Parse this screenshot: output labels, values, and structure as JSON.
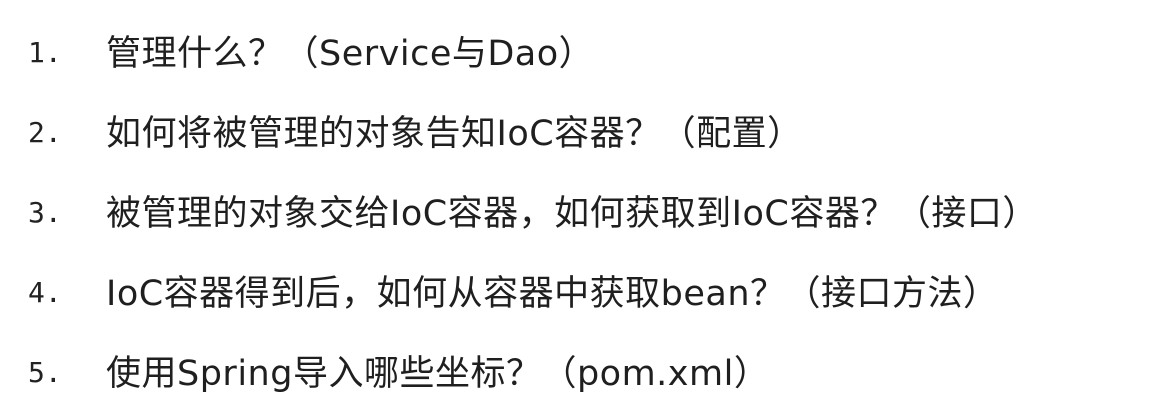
{
  "slide": {
    "items": [
      {
        "number": "1.",
        "text": "管理什么？（Service与Dao）"
      },
      {
        "number": "2.",
        "text": "如何将被管理的对象告知IoC容器？（配置）"
      },
      {
        "number": "3.",
        "text": "被管理的对象交给IoC容器，如何获取到IoC容器？（接口）"
      },
      {
        "number": "4.",
        "text": "IoC容器得到后，如何从容器中获取bean？（接口方法）"
      },
      {
        "number": "5.",
        "text": "使用Spring导入哪些坐标？（pom.xml）"
      }
    ]
  }
}
